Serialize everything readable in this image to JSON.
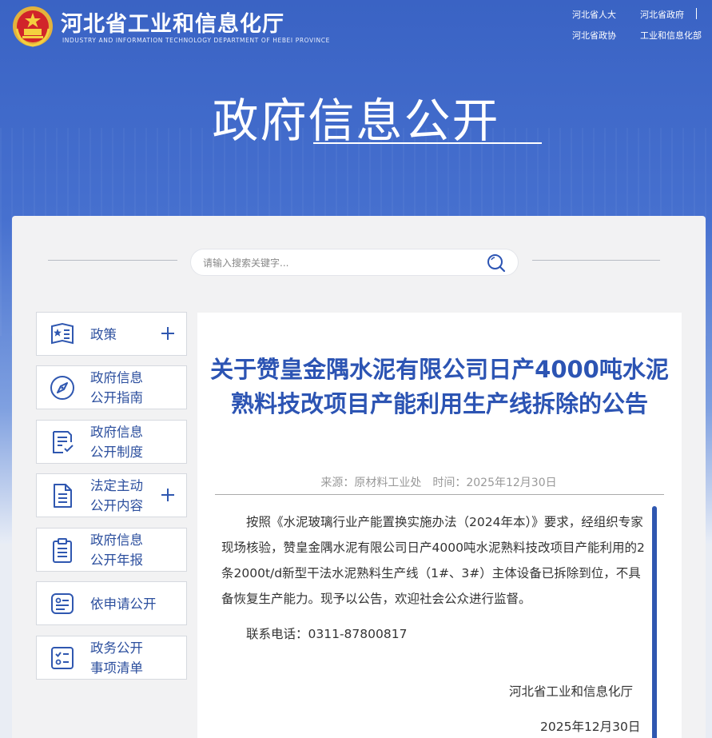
{
  "header": {
    "site_title": "河北省工业和信息化厅",
    "site_subtitle": "INDUSTRY AND INFORMATION TECHNOLOGY DEPARTMENT OF HEBEI PROVINCE",
    "links": [
      "河北省人大",
      "河北省政府",
      "河北省政协",
      "工业和信息化部"
    ]
  },
  "banner": {
    "title": "政府信息公开"
  },
  "search": {
    "placeholder": "请输入搜索关键字..."
  },
  "sidebar": {
    "items": [
      {
        "line1": "政策",
        "line2": "",
        "icon": "star-list-icon",
        "expandable": true
      },
      {
        "line1": "政府信息",
        "line2": "公开指南",
        "icon": "compass-icon",
        "expandable": false
      },
      {
        "line1": "政府信息",
        "line2": "公开制度",
        "icon": "document-check-icon",
        "expandable": false
      },
      {
        "line1": "法定主动",
        "line2": "公开内容",
        "icon": "document-lines-icon",
        "expandable": true
      },
      {
        "line1": "政府信息",
        "line2": "公开年报",
        "icon": "clipboard-icon",
        "expandable": false
      },
      {
        "line1": "依申请公开",
        "line2": "",
        "icon": "form-card-icon",
        "expandable": false
      },
      {
        "line1": "政务公开",
        "line2": "事项清单",
        "icon": "checklist-icon",
        "expandable": false
      }
    ]
  },
  "article": {
    "title": "关于赞皇金隅水泥有限公司日产4000吨水泥熟料技改项目产能利用生产线拆除的公告",
    "meta": "来源：原材料工业处　时间：2025年12月30日",
    "paragraph": "按照《水泥玻璃行业产能置换实施办法（2024年本）》要求，经组织专家现场核验，赞皇金隅水泥有限公司日产4000吨水泥熟料技改项目产能利用的2条2000t/d新型干法水泥熟料生产线（1#、3#）主体设备已拆除到位，不具备恢复生产能力。现予以公告，欢迎社会公众进行监督。",
    "contact": "联系电话：0311-87800817",
    "signature": "河北省工业和信息化厅",
    "date": "2025年12月30日"
  },
  "colors": {
    "brand_blue": "#3a63c4",
    "title_blue": "#2c54b3",
    "nav_text": "#2c4f9e"
  }
}
